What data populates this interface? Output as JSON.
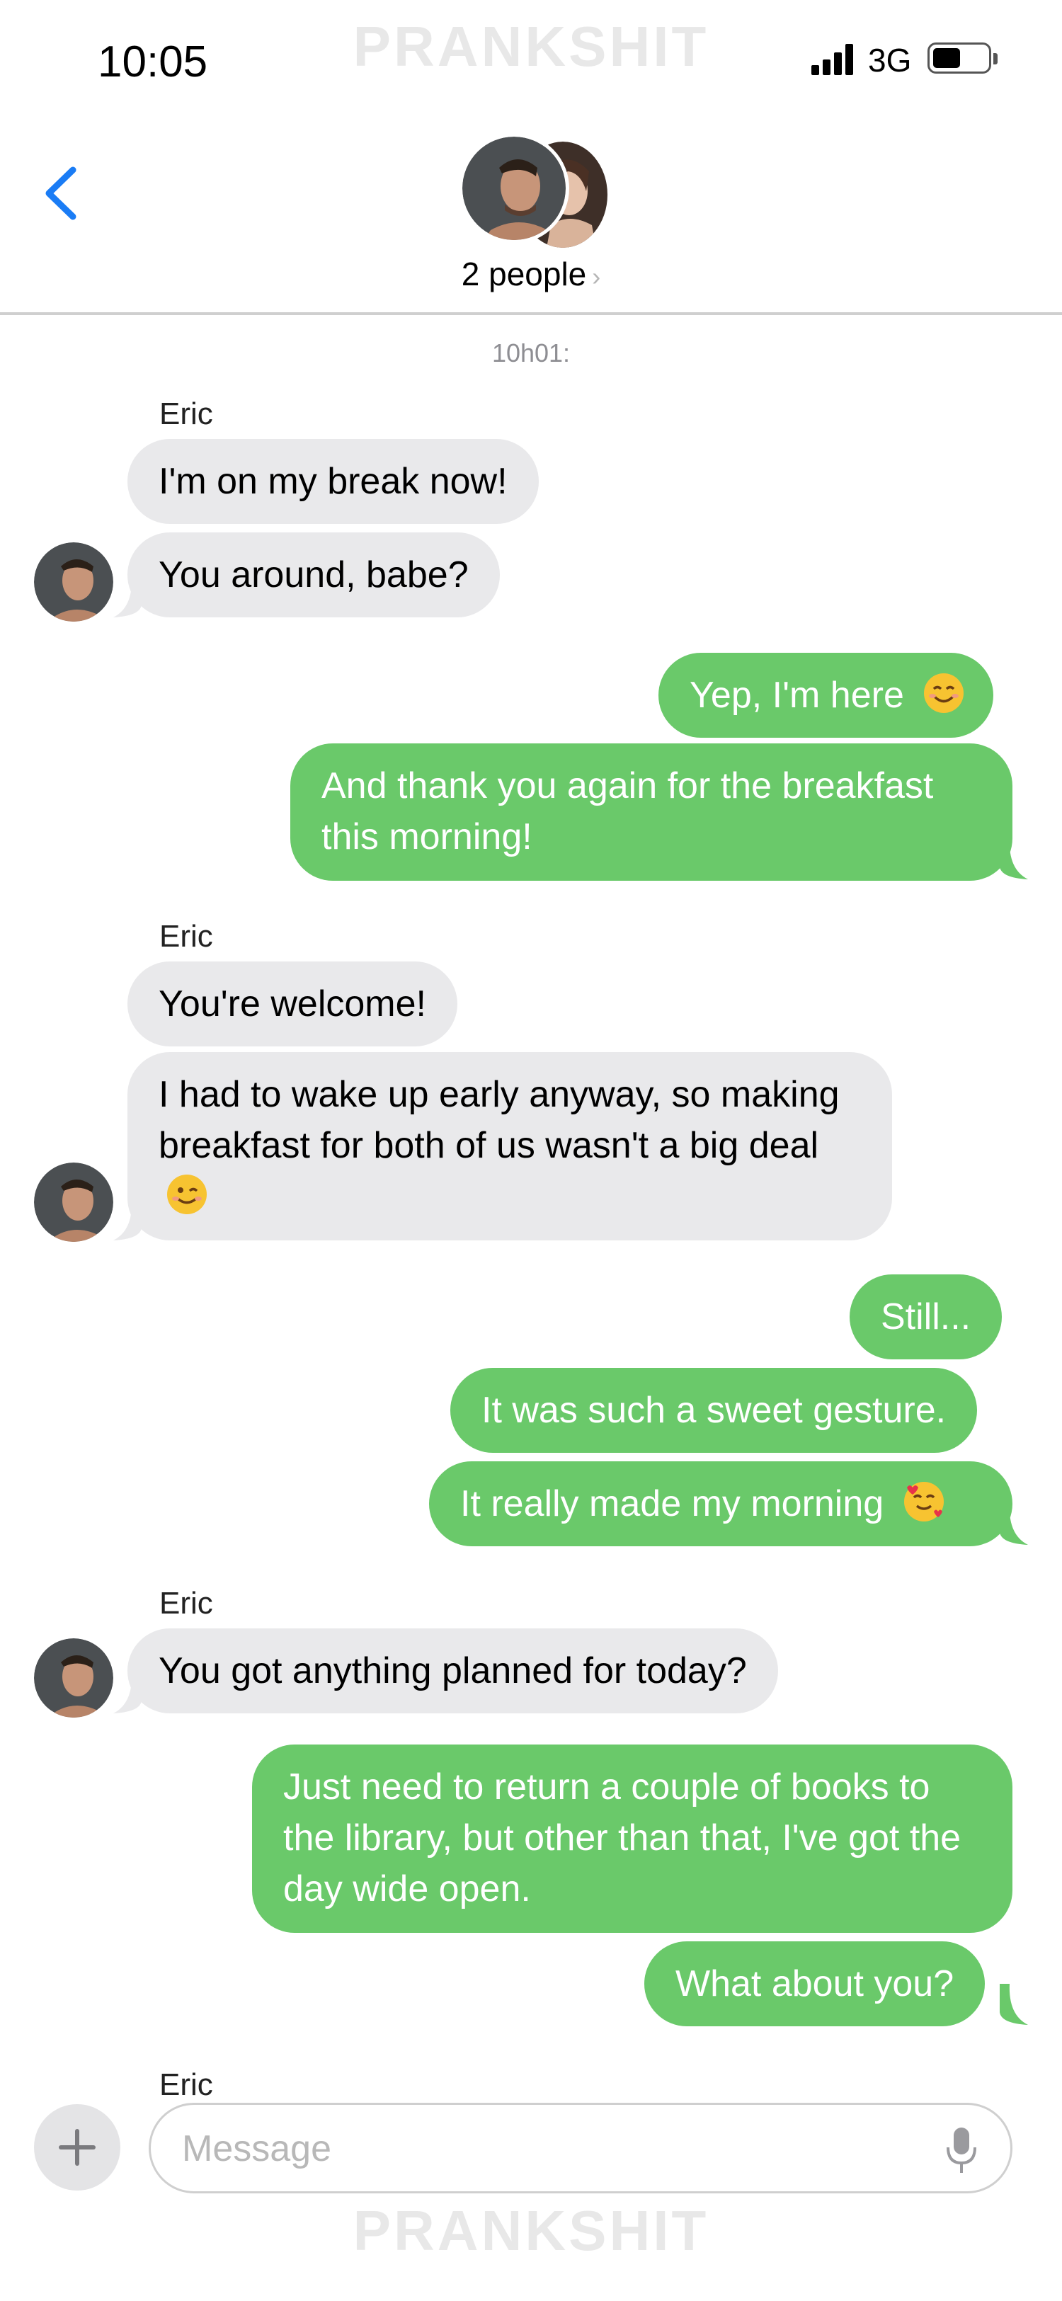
{
  "status_bar": {
    "time": "10:05",
    "network": "3G"
  },
  "watermark": "PRANKSHIT",
  "header": {
    "title": "2 people",
    "chevron": "›"
  },
  "timestamp": "10h01:",
  "messages": [
    {
      "sender": "Eric"
    },
    {
      "text": "I'm on my break now!"
    },
    {
      "text": "You around, babe?"
    },
    {
      "text": "Yep, I'm here"
    },
    {
      "text": "And thank you again for the breakfast this morning!"
    },
    {
      "sender": "Eric"
    },
    {
      "text": "You're welcome!"
    },
    {
      "text": "I had to wake up early anyway, so making breakfast for both of us wasn't a big deal"
    },
    {
      "text": "Still..."
    },
    {
      "text": "It was such a sweet gesture."
    },
    {
      "text": "It really made my morning"
    },
    {
      "sender": "Eric"
    },
    {
      "text": "You got anything planned for today?"
    },
    {
      "text": "Just need to return a couple of books to the library, but other than that, I've got the day wide open."
    },
    {
      "text": "What about you?"
    },
    {
      "sender": "Eric"
    }
  ],
  "composer": {
    "placeholder": "Message"
  },
  "colors": {
    "outgoing": "#6ac96a",
    "incoming": "#e9e9eb",
    "accent": "#1a7cf5"
  },
  "icons": [
    "back-chevron-icon",
    "signal-icon",
    "battery-icon",
    "plus-icon",
    "microphone-icon",
    "smiling-emoji",
    "winking-emoji",
    "hearts-emoji"
  ]
}
